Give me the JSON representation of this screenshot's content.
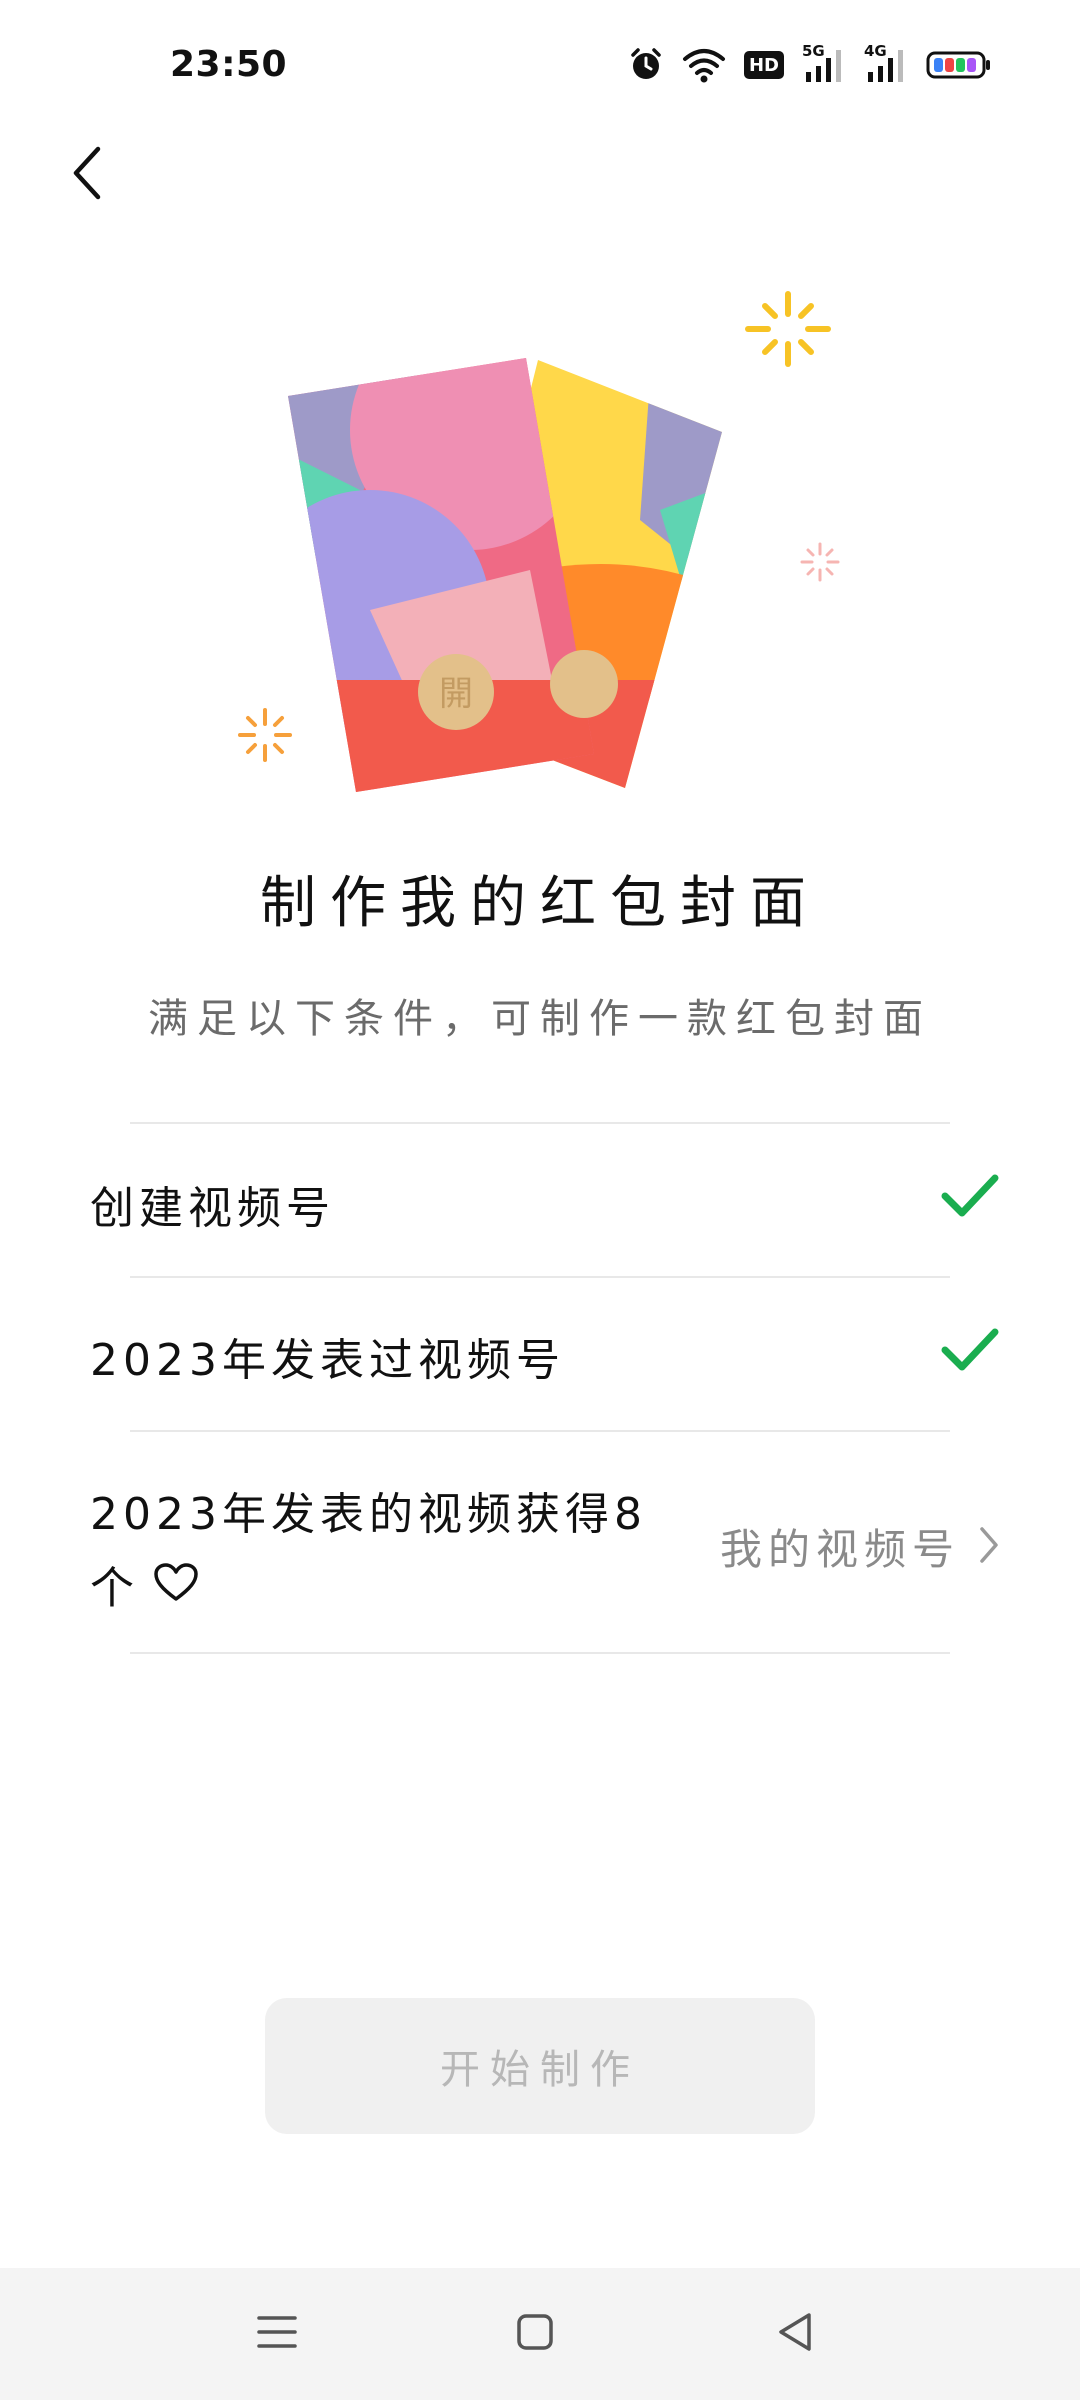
{
  "status_bar": {
    "time": "23:50",
    "icons": [
      "alarm-icon",
      "wifi-icon",
      "hd-icon",
      "signal-5g-icon",
      "signal-4g-icon",
      "battery-icon"
    ],
    "hd_label": "HD",
    "net1_label": "5G",
    "net2_label": "4G"
  },
  "header": {
    "back_icon": "chevron-left-icon"
  },
  "hero": {
    "envelope_seal_text": "開",
    "colors": {
      "red": "#f25a4c",
      "pink": "#ef8fb3",
      "purple": "#9e9ac8",
      "yellow": "#ffd84a",
      "orange": "#ff8a2a",
      "teal": "#5fd4b2",
      "seal": "#e3c08a"
    }
  },
  "main": {
    "title": "制作我的红包封面",
    "subtitle": "满足以下条件，可制作一款红包封面",
    "conditions": [
      {
        "text": "创建视频号",
        "status": "done"
      },
      {
        "text": "2023年发表过视频号",
        "status": "done"
      },
      {
        "text_line1": "2023年发表的视频获得8",
        "text_line2": "个",
        "status": "link",
        "link_label": "我的视频号"
      }
    ],
    "accent_color": "#1aad4f",
    "start_button_label": "开始制作"
  },
  "nav_bar": {
    "icons": [
      "menu-icon",
      "home-icon",
      "back-triangle-icon"
    ]
  }
}
